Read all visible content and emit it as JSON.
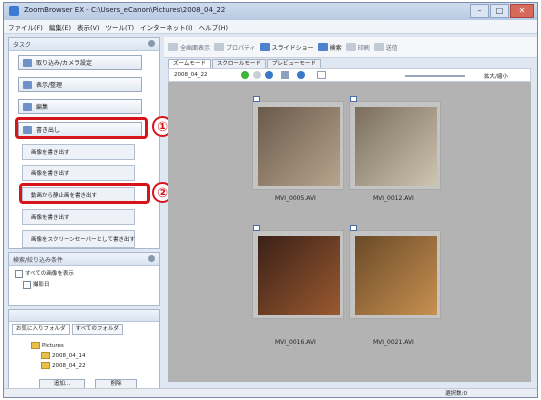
{
  "window": {
    "title": "ZoomBrowser EX - C:\\Users_eCanon\\Pictures\\2008_04_22",
    "min_label": "–",
    "max_label": "□",
    "close_label": "✕"
  },
  "menu": [
    "ファイル(F)",
    "編集(E)",
    "表示(V)",
    "ツール(T)",
    "インターネット(I)",
    "ヘルプ(H)"
  ],
  "left_panel": {
    "title": "タスク",
    "nav_buttons": [
      "取り込み/カメラ設定",
      "表示/整理",
      "編集",
      "書き出し"
    ],
    "sub_buttons": [
      "画像を書き出す",
      "画像を書き出す",
      "動画から静止画を書き出す",
      "画像を書き出す",
      "画像をスクリーンセーバーとして書き出す"
    ],
    "filter_title": "検索/絞り込み条件",
    "filter_items": [
      "すべての画像を表示",
      "撮影日"
    ],
    "folder_tabs": [
      "お気に入りフォルダ",
      "すべてのフォルダ"
    ],
    "folders": [
      "Pictures",
      "2008_04_14",
      "2008_04_22"
    ],
    "bottom_buttons": [
      "追加...",
      "削除"
    ]
  },
  "annotations": {
    "one": "①",
    "two": "②"
  },
  "toolbar": {
    "items": [
      "全画面表示",
      "プロパティ",
      "スライドショー",
      "検索",
      "印刷",
      "送信"
    ]
  },
  "mode_tabs": [
    "ズームモード",
    "スクロールモード",
    "プレビューモード"
  ],
  "subbar": {
    "date_label": "2008_04_22",
    "zoom_label": "拡大/縮小"
  },
  "thumbnails": [
    {
      "name": "MVI_0005.AVI",
      "colors": [
        "#6a5a4a",
        "#b8a48e"
      ]
    },
    {
      "name": "MVI_0012.AVI",
      "colors": [
        "#7a6d5c",
        "#cfc5b3"
      ]
    },
    {
      "name": "MVI_0016.AVI",
      "colors": [
        "#3a2018",
        "#9a5a30"
      ]
    },
    {
      "name": "MVI_0021.AVI",
      "colors": [
        "#6a4a28",
        "#c89050"
      ]
    }
  ],
  "status": {
    "text": "選択数:0"
  }
}
